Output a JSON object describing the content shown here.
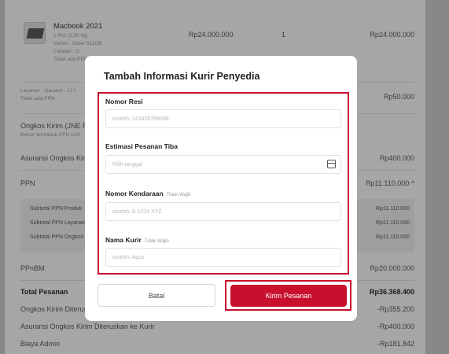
{
  "product": {
    "name": "Macbook 2021",
    "qty_weight": "1 Pcs (2,50 kg)",
    "variant": "Varian : Silver 512GB",
    "note": "Catatan : D",
    "tax_note": "Tidak ada PPN",
    "price": "Rp24.000.000",
    "qty": "1",
    "total": "Rp24.000.000"
  },
  "summary": {
    "service_label": "Layanan : Garansi - 12 t",
    "service_sub": "Tidak ada PPN",
    "service_amount": "Rp50.000",
    "shipping_label": "Ongkos Kirim (JNE Re",
    "shipping_sub": "Belum termasuk PPN 11%",
    "insurance_label": "Asuransi Ongkos Kiri",
    "insurance_amount": "Rp400.000",
    "ppn_label": "PPN",
    "ppn_amount": "Rp11.110.000 ^",
    "ppn_rows": [
      {
        "label": "Subtotal PPN Produk",
        "amount": "Rp11.110.000"
      },
      {
        "label": "Subtotal PPN Layanan",
        "amount": "Rp11.110.000"
      },
      {
        "label": "Subtotal PPN Ongkos",
        "amount": "Rp11.110.000"
      }
    ],
    "ppnbm_label": "PPnBM",
    "ppnbm_amount": "Rp20.000.000",
    "total_label": "Total Pesanan",
    "total_amount": "Rp36.368.400",
    "fwd_label": "Ongkos Kirim Diterus",
    "fwd_amount": "-Rp355.200",
    "ins_fwd_label": "Asuransi Ongkos Kirim Diteruskan ke Kurir",
    "ins_fwd_amount": "-Rp400.000",
    "admin_label": "Biaya Admin",
    "admin_amount": "-Rp181.842"
  },
  "modal": {
    "title": "Tambah Informasi Kurir Penyedia",
    "fields": {
      "resi": {
        "label": "Nomor Resi",
        "placeholder": "contoh: 123456789098"
      },
      "eta": {
        "label": "Estimasi Pesanan Tiba",
        "placeholder": "Pilih tanggal"
      },
      "vehicle": {
        "label": "Nomor Kendaraan",
        "optional": "Tidak Wajib",
        "placeholder": "contoh: B 1234 XYZ"
      },
      "courier": {
        "label": "Nama Kurir",
        "optional": "Tidak Wajib",
        "placeholder": "contoh: Agus"
      }
    },
    "cancel": "Batal",
    "submit": "Kirim Pesanan"
  },
  "colors": {
    "primary": "#c8102e",
    "highlight": "#c8102e"
  }
}
